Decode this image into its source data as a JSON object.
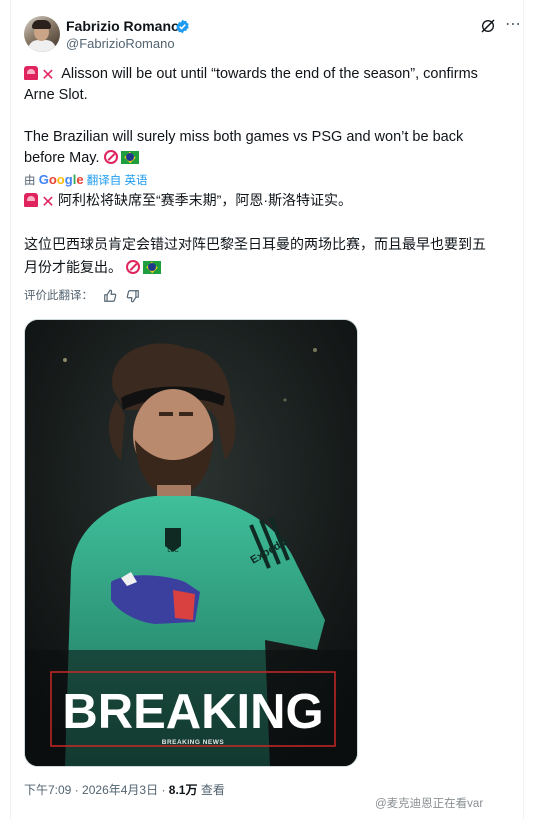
{
  "author": {
    "name": "Fabrizio Romano",
    "handle": "@FabrizioRomano"
  },
  "icons": {
    "verified": "verified-badge-icon",
    "grok": "grok-icon",
    "more": "more-icon",
    "siren": "rotating-light-icon",
    "cross": "cross-mark-icon",
    "no_entry": "no-entry-icon",
    "flag": "brazil-flag-icon",
    "thumbs_up": "thumbs-up-icon",
    "thumbs_down": "thumbs-down-icon"
  },
  "colors": {
    "accent": "#1d9bf0",
    "text": "#0f1419",
    "muted": "#536471"
  },
  "tweet": {
    "line1": "Alisson will be out until “towards the end of the season”, confirms",
    "line2": "Arne Slot.",
    "line3": "The Brazilian will surely miss both games vs PSG and won’t be back",
    "line4": "before May.",
    "translated_by_prefix": "由",
    "translated_by_brand": "Google",
    "translated_from": "翻译自 英语",
    "cn_line1": "阿利松将缺席至“赛季末期”，阿恩·斯洛特证实。",
    "cn_line2": "这位巴西球员肯定会错过对阵巴黎圣日耳曼的两场比赛，而且最早也要到五",
    "cn_line3": "月份才能复出。",
    "rate_translation": "评价此翻译："
  },
  "media": {
    "headline": "BREAKING",
    "subline": "BREAKING NEWS",
    "kit_sponsor": "Expedia",
    "club_badge": "LFC"
  },
  "footer": {
    "time": "下午7:09",
    "date": "2026年4月3日",
    "separator": "·",
    "views_value": "8.1万",
    "views_label": "查看"
  },
  "watermark": "@麦克迪恩正在看var"
}
